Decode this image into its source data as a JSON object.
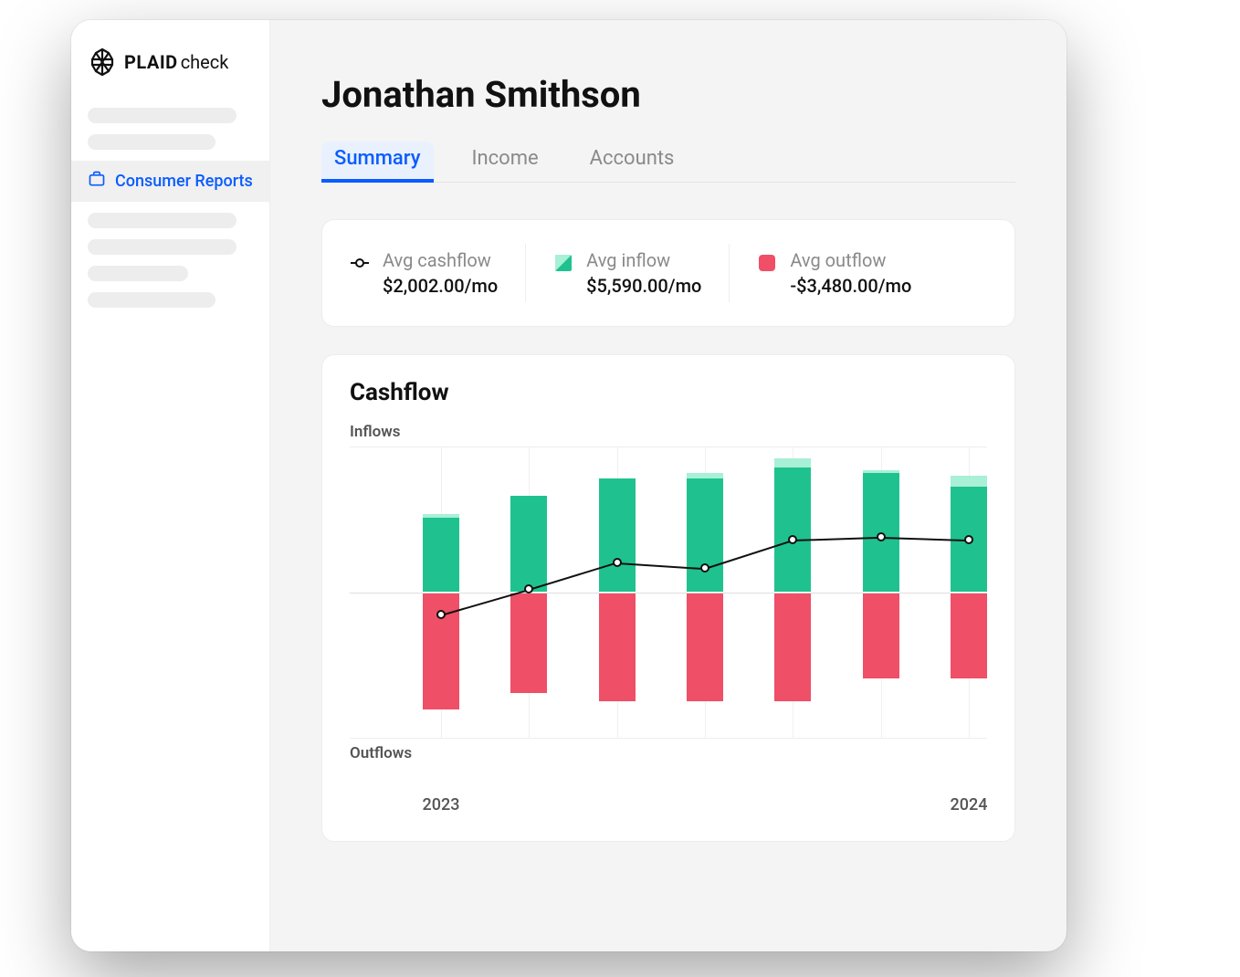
{
  "brand": {
    "name": "PLAID",
    "product": "check"
  },
  "sidebar": {
    "active_item_label": "Consumer Reports"
  },
  "page": {
    "title": "Jonathan Smithson"
  },
  "tabs": [
    {
      "label": "Summary",
      "active": true
    },
    {
      "label": "Income",
      "active": false
    },
    {
      "label": "Accounts",
      "active": false
    }
  ],
  "stats": {
    "cashflow": {
      "label": "Avg cashflow",
      "value": "$2,002.00/mo"
    },
    "inflow": {
      "label": "Avg inflow",
      "value": "$5,590.00/mo"
    },
    "outflow": {
      "label": "Avg outflow",
      "value": "-$3,480.00/mo"
    }
  },
  "chart": {
    "title": "Cashflow",
    "y_top_label": "Inflows",
    "y_bottom_label": "Outflows",
    "x_start": "2023",
    "x_end": "2024"
  },
  "chart_data": {
    "type": "bar",
    "title": "Cashflow",
    "y_top_label": "Inflows",
    "y_bottom_label": "Outflows",
    "x_start_label": "2023",
    "x_end_label": "2024",
    "n_periods": 7,
    "series": [
      {
        "name": "inflow_main",
        "values": [
          52,
          68,
          80,
          80,
          88,
          84,
          74
        ]
      },
      {
        "name": "inflow_extra",
        "values": [
          3,
          0,
          0,
          4,
          6,
          2,
          8
        ]
      },
      {
        "name": "outflow",
        "values": [
          82,
          70,
          76,
          76,
          76,
          60,
          60
        ]
      },
      {
        "name": "net_cashflow",
        "values": [
          -15,
          3,
          22,
          18,
          38,
          40,
          38
        ]
      }
    ],
    "note": "values are relative units read from bar heights; zero line is the horizontal midline"
  }
}
